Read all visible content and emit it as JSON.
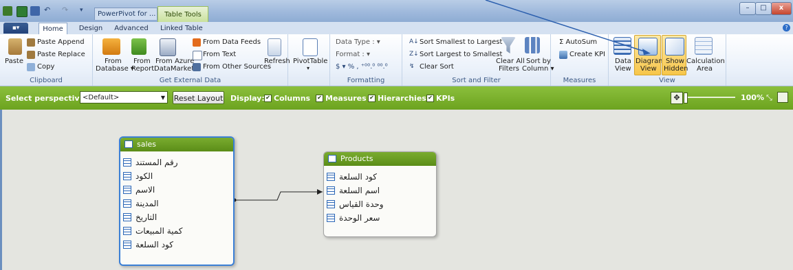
{
  "title_bar": {
    "app_title": "PowerPivot for ...",
    "context_tab": "Table Tools",
    "minimize": "–",
    "maximize": "□",
    "close": "x"
  },
  "tabs": {
    "file": "▪▾",
    "items": [
      "Home",
      "Design",
      "Advanced",
      "Linked Table"
    ],
    "active": "Home"
  },
  "ribbon": {
    "clipboard": {
      "label": "Clipboard",
      "paste": "Paste",
      "paste_append": "Paste Append",
      "paste_replace": "Paste Replace",
      "copy": "Copy"
    },
    "external": {
      "label": "Get External Data",
      "from_database": "From",
      "from_database2": "Database ▾",
      "from_report": "From",
      "from_report2": "Report",
      "from_azure": "From Azure",
      "from_azure2": "DataMarket",
      "from_data_feeds": "From Data Feeds",
      "from_text": "From Text",
      "from_other": "From Other Sources",
      "refresh": "Refresh"
    },
    "pivot": {
      "label": "PivotTable",
      "arrow": "▾"
    },
    "formatting": {
      "label": "Formatting",
      "data_type": "Data Type : ▾",
      "format": "Format : ▾",
      "symbols": "$ ▾  %  ,  ⁺⁰⁰.⁰  ⁰⁰.⁰"
    },
    "sort_filter": {
      "label": "Sort and Filter",
      "sort_smallest": "Sort Smallest to Largest",
      "sort_largest": "Sort Largest to Smallest",
      "clear_sort": "Clear Sort",
      "clear_all_filters": "Clear All",
      "clear_all_filters2": "Filters",
      "sort_by_column": "Sort by",
      "sort_by_column2": "Column ▾"
    },
    "measures": {
      "label": "Measures",
      "autosum": "Σ AutoSum",
      "create_kpi": "Create KPI"
    },
    "view": {
      "label": "View",
      "data_view": "Data",
      "data_view2": "View",
      "diagram_view": "Diagram",
      "diagram_view2": "View",
      "show_hidden": "Show",
      "show_hidden2": "Hidden",
      "calculation_area": "Calculation",
      "calculation_area2": "Area"
    }
  },
  "perspective_bar": {
    "select_label": "Select perspective:",
    "selected": "<Default>",
    "reset_layout": "Reset Layout",
    "display_label": "Display:",
    "options": [
      "Columns",
      "Measures",
      "Hierarchies",
      "KPIs"
    ],
    "checkmark": "✔",
    "zoom": "100%",
    "fit_icon": "✥"
  },
  "diagram": {
    "tables": [
      {
        "name": "sales",
        "fields": [
          "رقم المستند",
          "الكود",
          "الاسم",
          "المدينة",
          "التاريخ",
          "كمية المبيعات",
          "كود السلعة"
        ]
      },
      {
        "name": "Products",
        "fields": [
          "كود السلعة",
          "اسم السلعة",
          "وحدة القياس",
          "سعر الوحدة"
        ]
      }
    ]
  },
  "colors": {
    "accent_green": "#6ca31f",
    "ribbon_blue": "#d5e1f1",
    "selection_blue": "#3a7fd6",
    "highlight_orange": "#f7c64a"
  }
}
